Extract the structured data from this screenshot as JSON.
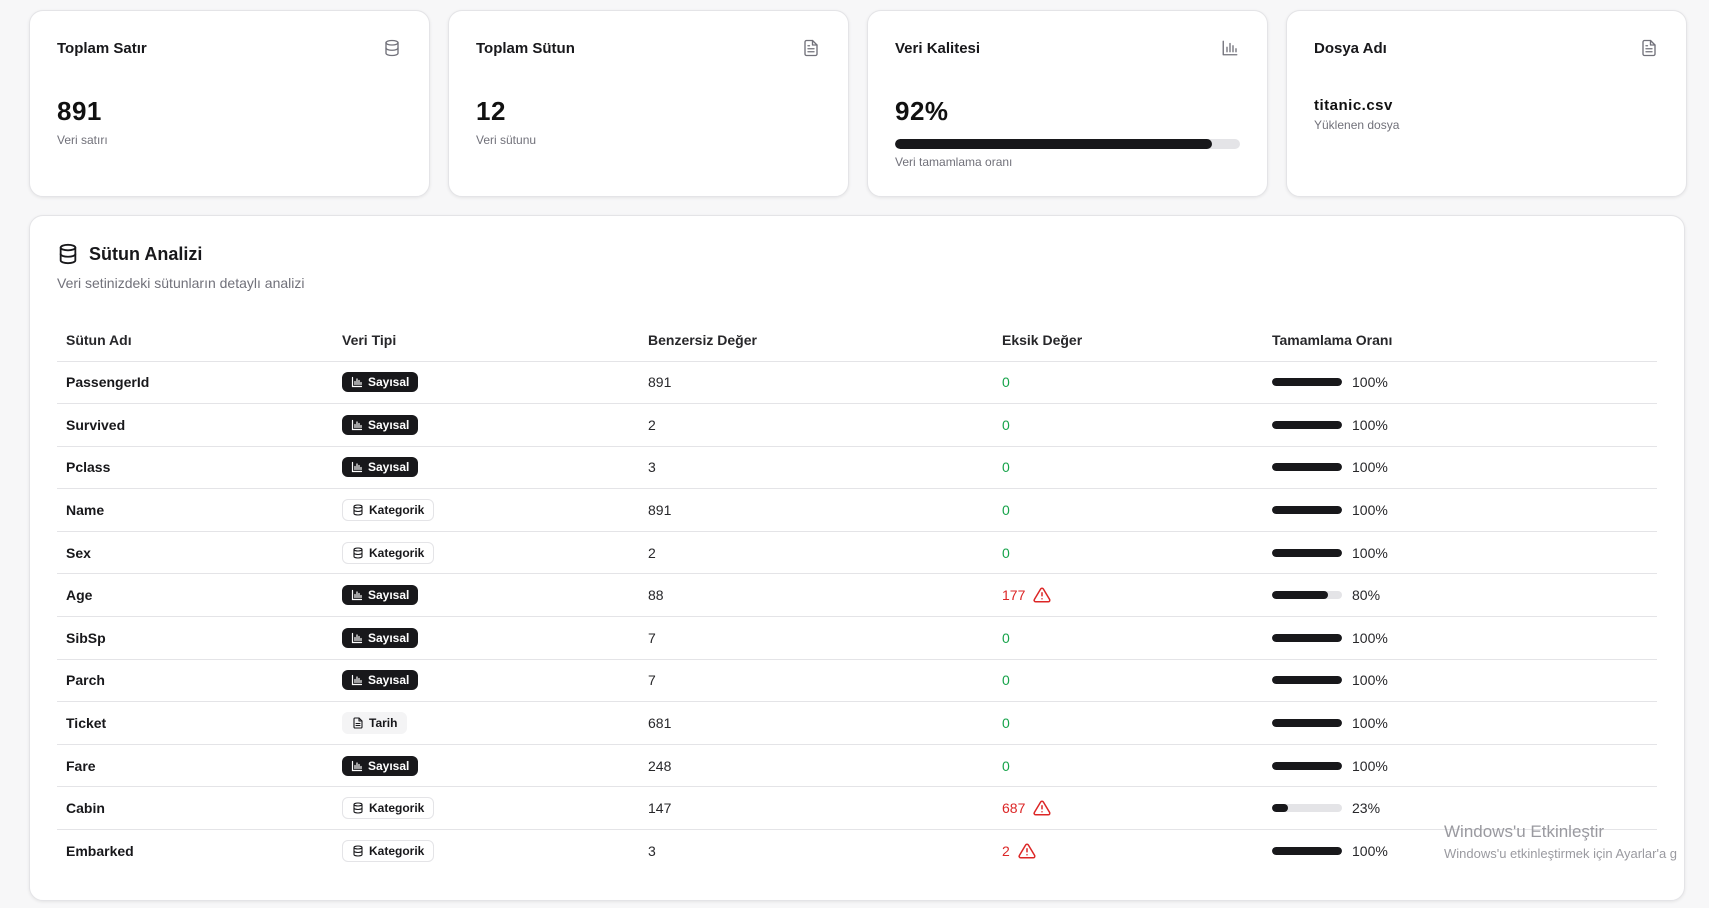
{
  "cards": [
    {
      "title": "Toplam Satır",
      "icon": "database-icon",
      "value": "891",
      "sub": "Veri satırı"
    },
    {
      "title": "Toplam Sütun",
      "icon": "file-text-icon",
      "value": "12",
      "sub": "Veri sütunu"
    },
    {
      "title": "Veri Kalitesi",
      "icon": "bar-chart-icon",
      "value": "92%",
      "progress": 0.92,
      "sub": "Veri tamamlama oranı"
    },
    {
      "title": "Dosya Adı",
      "icon": "file-text-icon",
      "value": "titanic.csv",
      "sub": "Yüklenen dosya"
    }
  ],
  "panel": {
    "title": "Sütun Analizi",
    "icon": "database-icon",
    "description": "Veri setinizdeki sütunların detaylı analizi"
  },
  "table": {
    "headers": [
      "Sütun Adı",
      "Veri Tipi",
      "Benzersiz Değer",
      "Eksik Değer",
      "Tamamlama Oranı"
    ],
    "rows": [
      {
        "name": "PassengerId",
        "type": "Sayısal",
        "kind": "numeric",
        "unique": "891",
        "missing": "0",
        "warn": false,
        "pct": "100%",
        "frac": 1.0
      },
      {
        "name": "Survived",
        "type": "Sayısal",
        "kind": "numeric",
        "unique": "2",
        "missing": "0",
        "warn": false,
        "pct": "100%",
        "frac": 1.0
      },
      {
        "name": "Pclass",
        "type": "Sayısal",
        "kind": "numeric",
        "unique": "3",
        "missing": "0",
        "warn": false,
        "pct": "100%",
        "frac": 1.0
      },
      {
        "name": "Name",
        "type": "Kategorik",
        "kind": "cat",
        "unique": "891",
        "missing": "0",
        "warn": false,
        "pct": "100%",
        "frac": 1.0
      },
      {
        "name": "Sex",
        "type": "Kategorik",
        "kind": "cat",
        "unique": "2",
        "missing": "0",
        "warn": false,
        "pct": "100%",
        "frac": 1.0
      },
      {
        "name": "Age",
        "type": "Sayısal",
        "kind": "numeric",
        "unique": "88",
        "missing": "177",
        "warn": true,
        "pct": "80%",
        "frac": 0.8
      },
      {
        "name": "SibSp",
        "type": "Sayısal",
        "kind": "numeric",
        "unique": "7",
        "missing": "0",
        "warn": false,
        "pct": "100%",
        "frac": 1.0
      },
      {
        "name": "Parch",
        "type": "Sayısal",
        "kind": "numeric",
        "unique": "7",
        "missing": "0",
        "warn": false,
        "pct": "100%",
        "frac": 1.0
      },
      {
        "name": "Ticket",
        "type": "Tarih",
        "kind": "date",
        "unique": "681",
        "missing": "0",
        "warn": false,
        "pct": "100%",
        "frac": 1.0
      },
      {
        "name": "Fare",
        "type": "Sayısal",
        "kind": "numeric",
        "unique": "248",
        "missing": "0",
        "warn": false,
        "pct": "100%",
        "frac": 1.0
      },
      {
        "name": "Cabin",
        "type": "Kategorik",
        "kind": "cat",
        "unique": "147",
        "missing": "687",
        "warn": true,
        "pct": "23%",
        "frac": 0.23
      },
      {
        "name": "Embarked",
        "type": "Kategorik",
        "kind": "cat",
        "unique": "3",
        "missing": "2",
        "warn": true,
        "pct": "100%",
        "frac": 1.0
      }
    ]
  },
  "watermark": {
    "line1": "Windows'u Etkinleştir",
    "line2": "Windows'u etkinleştirmek için Ayarlar'a g"
  },
  "colors": {
    "accent": "#18181b",
    "ok": "#16a34a",
    "warn": "#dc2626",
    "muted": "#71717a"
  }
}
